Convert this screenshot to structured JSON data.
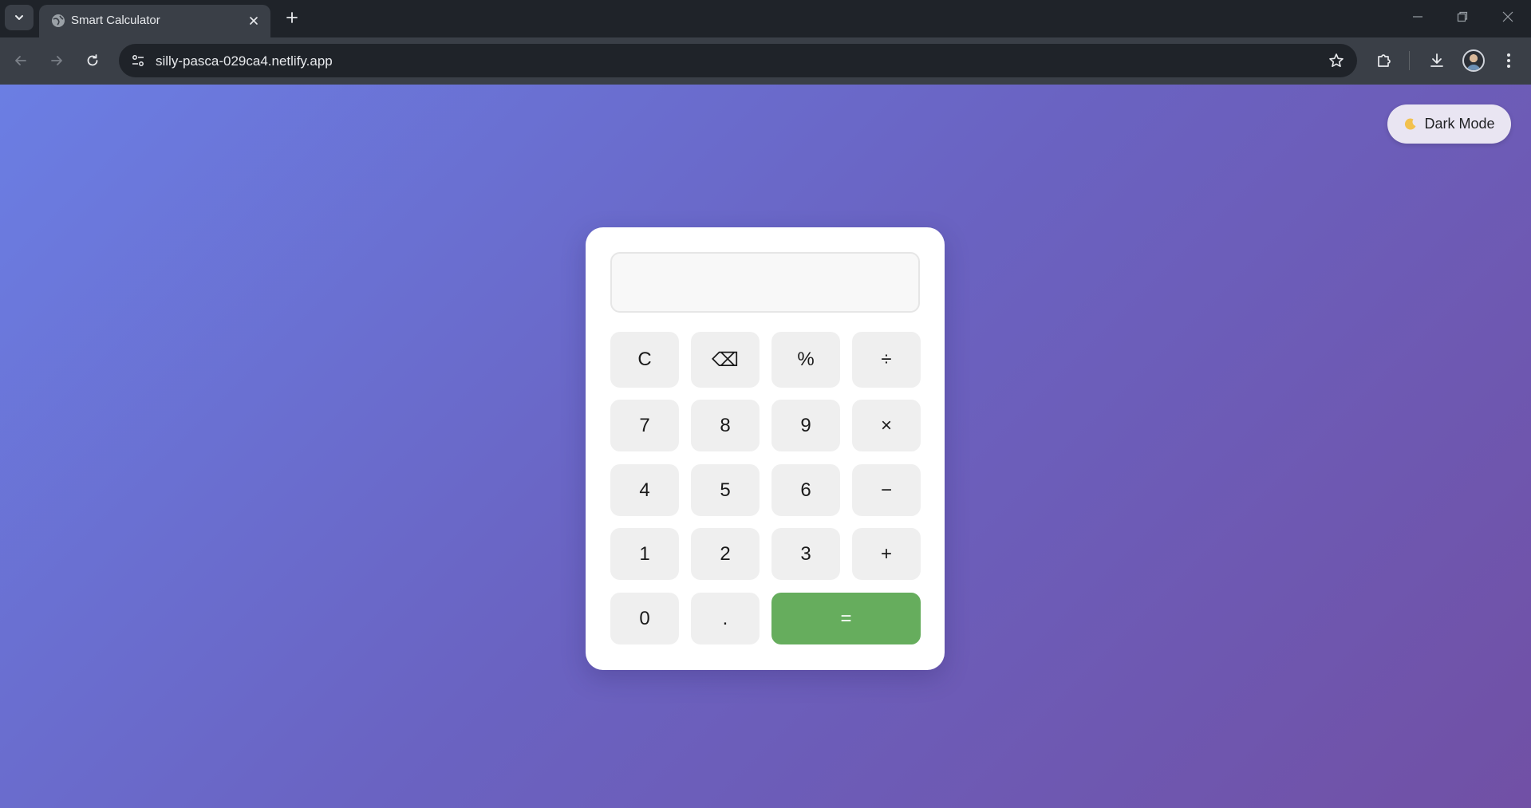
{
  "browser": {
    "tab_title": "Smart Calculator",
    "url": "silly-pasca-029ca4.netlify.app"
  },
  "page": {
    "dark_mode_label": "Dark Mode",
    "dark_mode_icon": "moon-icon",
    "display_value": ""
  },
  "keypad": {
    "row1": [
      "C",
      "⌫",
      "%",
      "÷"
    ],
    "row2": [
      "7",
      "8",
      "9",
      "×"
    ],
    "row3": [
      "4",
      "5",
      "6",
      "−"
    ],
    "row4": [
      "1",
      "2",
      "3",
      "+"
    ],
    "row5": [
      "0",
      ".",
      "="
    ]
  },
  "colors": {
    "equals_button": "#66ad5d",
    "key_background": "#efefef",
    "background_gradient_start": "#6b7ee3",
    "background_gradient_end": "#7150a5"
  }
}
